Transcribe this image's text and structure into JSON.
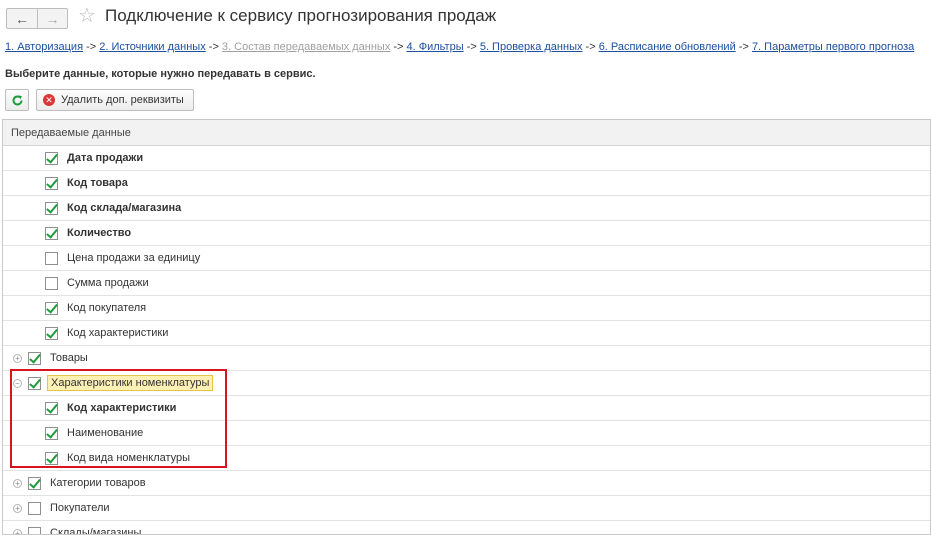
{
  "window": {
    "title": "Подключение к сервису прогнозирования продаж",
    "back_icon": "arrow-left-icon",
    "forward_icon": "arrow-right-icon",
    "favorite_icon": "star-icon"
  },
  "breadcrumb": [
    {
      "label": "1. Авторизация",
      "state": "link"
    },
    {
      "label": "2. Источники данных",
      "state": "link"
    },
    {
      "label": "3. Состав передаваемых данных",
      "state": "current"
    },
    {
      "label": "4. Фильтры",
      "state": "link"
    },
    {
      "label": "5. Проверка данных",
      "state": "link"
    },
    {
      "label": "6. Расписание обновлений",
      "state": "link"
    },
    {
      "label": "7. Параметры первого прогноза",
      "state": "link"
    }
  ],
  "breadcrumb_separator": " -> ",
  "prompt": "Выберите данные, которые нужно передавать в сервис.",
  "toolbar": {
    "refresh_icon": "refresh-icon",
    "delete_label": "Удалить доп. реквизиты",
    "delete_icon": "close-circle-icon"
  },
  "table": {
    "header": "Передаваемые данные",
    "rows": [
      {
        "label": "Дата продажи",
        "checked": true,
        "bold": true,
        "level": "child"
      },
      {
        "label": "Код товара",
        "checked": true,
        "bold": true,
        "level": "child"
      },
      {
        "label": "Код склада/магазина",
        "checked": true,
        "bold": true,
        "level": "child"
      },
      {
        "label": "Количество",
        "checked": true,
        "bold": true,
        "level": "child"
      },
      {
        "label": "Цена продажи за единицу",
        "checked": false,
        "bold": false,
        "level": "child"
      },
      {
        "label": "Сумма продажи",
        "checked": false,
        "bold": false,
        "level": "child"
      },
      {
        "label": "Код покупателя",
        "checked": true,
        "bold": false,
        "level": "child"
      },
      {
        "label": "Код характеристики",
        "checked": true,
        "bold": false,
        "level": "child"
      },
      {
        "label": "Товары",
        "checked": true,
        "bold": false,
        "level": "top",
        "expander": "+"
      },
      {
        "label": "Характеристики номенклатуры",
        "checked": true,
        "bold": false,
        "level": "top",
        "expander": "−",
        "selected": true
      },
      {
        "label": "Код характеристики",
        "checked": true,
        "bold": true,
        "level": "child"
      },
      {
        "label": "Наименование",
        "checked": true,
        "bold": false,
        "level": "child"
      },
      {
        "label": "Код вида номенклатуры",
        "checked": true,
        "bold": false,
        "level": "child"
      },
      {
        "label": "Категории товаров",
        "checked": true,
        "bold": false,
        "level": "top",
        "expander": "+"
      },
      {
        "label": "Покупатели",
        "checked": false,
        "bold": false,
        "level": "top",
        "expander": "+"
      },
      {
        "label": "Склады/магазины",
        "checked": false,
        "bold": false,
        "level": "top",
        "expander": "+"
      }
    ]
  },
  "colors": {
    "accent_link": "#1c4fa0",
    "check": "#1e9c3b",
    "highlight_box": "#d9141d",
    "selection": "#fdf0b5"
  }
}
